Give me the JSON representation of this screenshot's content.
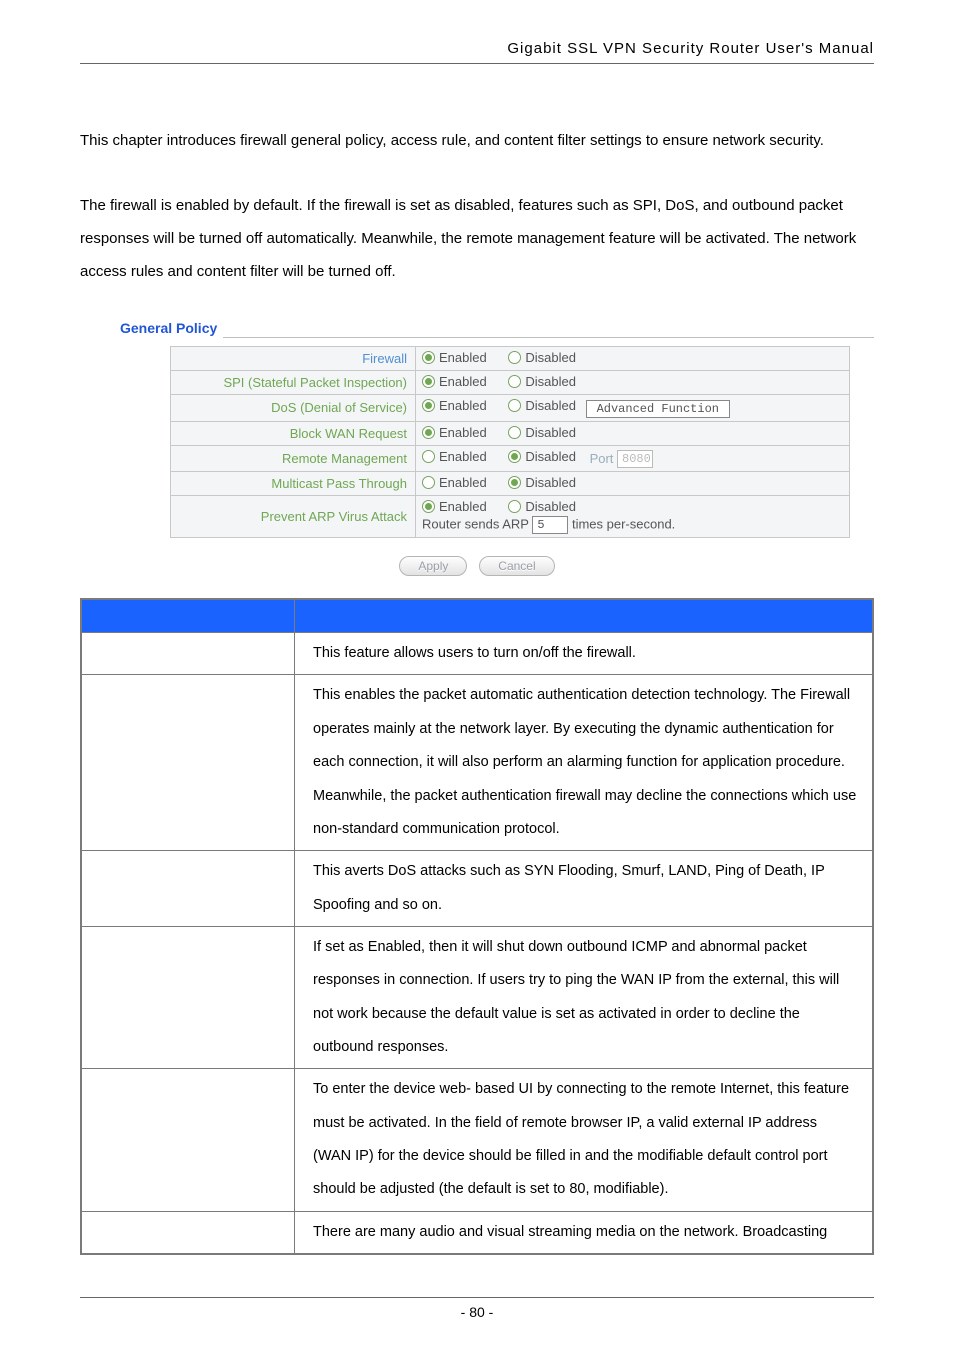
{
  "header": {
    "title": "Gigabit SSL VPN Security Router User's Manual"
  },
  "paragraphs": {
    "p1": "This chapter introduces firewall general policy, access rule, and content filter settings to ensure network security.",
    "p2": "The firewall is enabled by default. If the firewall is set as disabled, features such as SPI, DoS, and outbound packet responses will be turned off automatically. Meanwhile, the remote management feature will be activated. The network access rules and content filter will be turned off."
  },
  "section_title": "General Policy",
  "radio": {
    "enabled": "Enabled",
    "disabled": "Disabled"
  },
  "config": {
    "firewall_label": "Firewall",
    "spi_label": "SPI (Stateful Packet Inspection)",
    "dos_label": "DoS (Denial of Service)",
    "dos_button": "Advanced Function",
    "block_wan_label": "Block WAN Request",
    "remote_mgmt_label": "Remote Management",
    "remote_port_prefix": "Port",
    "remote_port_value": "8080",
    "multicast_label": "Multicast Pass Through",
    "arp_label": "Prevent ARP Virus Attack",
    "arp_line2_a": "Router sends ARP",
    "arp_value": "5",
    "arp_line2_b": "times per-second."
  },
  "buttons": {
    "apply": "Apply",
    "cancel": "Cancel"
  },
  "desc": {
    "r1": "This feature allows users to turn on/off the firewall.",
    "r2": "This enables the packet automatic authentication detection technology. The Firewall operates mainly at the network layer. By executing the dynamic authentication for each connection, it will also perform an alarming function for application procedure. Meanwhile, the packet authentication firewall may decline the connections which use non-standard communication protocol.",
    "r3": "This averts DoS attacks such as SYN Flooding, Smurf, LAND, Ping of Death, IP Spoofing and so on.",
    "r4": "If set as Enabled, then it will shut down outbound ICMP and abnormal packet responses in connection. If users try to ping the WAN IP from the external, this will not work because the default value is set as activated in order to decline the outbound responses.",
    "r5": "To enter the device web- based UI by connecting to the remote Internet, this feature must be activated. In the field of remote browser IP, a valid external IP address (WAN IP) for the device should be filled in and the modifiable default control port should be adjusted (the default is set to 80, modifiable).",
    "r6": "There are many audio and visual streaming media on the network. Broadcasting"
  },
  "footer": {
    "page": "- 80 -"
  }
}
